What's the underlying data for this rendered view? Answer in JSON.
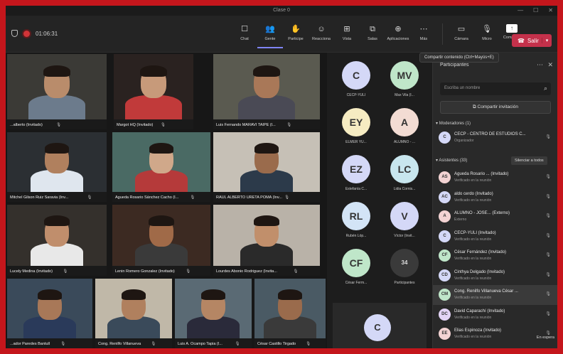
{
  "window": {
    "title": "Clase 0",
    "controls": [
      "—",
      "☐",
      "✕"
    ]
  },
  "toolbar": {
    "timer": "01:06:31",
    "buttons": [
      {
        "label": "Chat",
        "icon": "chat-icon",
        "glyph": "☐"
      },
      {
        "label": "Gente",
        "icon": "people-icon",
        "glyph": "👥"
      },
      {
        "label": "Participe",
        "icon": "raise-hand-icon",
        "glyph": "✋"
      },
      {
        "label": "Reacciona",
        "icon": "reactions-icon",
        "glyph": "☺"
      },
      {
        "label": "Vista",
        "icon": "view-icon",
        "glyph": "⊞"
      },
      {
        "label": "Salas",
        "icon": "rooms-icon",
        "glyph": "⧉"
      },
      {
        "label": "Aplicaciones",
        "icon": "apps-icon",
        "glyph": "⊕"
      },
      {
        "label": "Más",
        "icon": "more-icon",
        "glyph": "⋯"
      }
    ],
    "device_buttons": [
      {
        "label": "Cámara",
        "icon": "camera-icon",
        "glyph": "▭"
      },
      {
        "label": "Micro",
        "icon": "mic-icon",
        "glyph": "🎙"
      },
      {
        "label": "Compartir",
        "icon": "share-icon",
        "glyph": "↑"
      }
    ],
    "leave_label": "Salir",
    "share_tooltip": "Compartir contenido (Ctrl+Mayús+E)"
  },
  "tiles": [
    {
      "name": "...alberto (Invitado)"
    },
    {
      "name": "Margot HQ (Invitado)"
    },
    {
      "name": "Luis Fernando MARAVI TAIPE (I..."
    },
    {
      "name": "Mitchel Gilson Ruiz Saravia (Inv..."
    },
    {
      "name": "Agueda Rosario Sánchez Cacho (I..."
    },
    {
      "name": "RAUL ALBERTO URETA POMA (Inv..."
    },
    {
      "name": "Lucely Medina (Invitado)"
    },
    {
      "name": "Lenin Romero Gonzalez (Invitado)"
    },
    {
      "name": "Lourdes Abonio Rodriguez (Invita..."
    },
    {
      "name": "...ador Paredes Bantull"
    },
    {
      "name": "Cong. Renilfo Villanueva"
    },
    {
      "name": "Luis A. Ocampo Tapia (I..."
    },
    {
      "name": "César Castillo Tirgado"
    }
  ],
  "avatars": [
    {
      "initials": "C",
      "name": "CECP-YULI",
      "color": "#d4d8f7"
    },
    {
      "initials": "MV",
      "name": "Max Vila (I...",
      "color": "#bfe6c9"
    },
    {
      "initials": "EY",
      "name": "ELMER YU...",
      "color": "#f6ecc2"
    },
    {
      "initials": "A",
      "name": "ALUMNO - ...",
      "color": "#f3dcd3"
    },
    {
      "initials": "EZ",
      "name": "Estefanía C...",
      "color": "#d4d8f7"
    },
    {
      "initials": "LC",
      "name": "Lidia Cornis...",
      "color": "#c8e6ee"
    },
    {
      "initials": "RL",
      "name": "Rubén Lóp...",
      "color": "#d3e4f6"
    },
    {
      "initials": "V",
      "name": "Víctor (Invit...",
      "color": "#d4d8f7"
    },
    {
      "initials": "CF",
      "name": "César Ferm...",
      "color": "#bfe6c9"
    },
    {
      "initials": "34",
      "name": "Participantes",
      "color": "#3a3a3a"
    }
  ],
  "self_tile": {
    "initials": "C"
  },
  "panel": {
    "title": "Participantes",
    "search_placeholder": "Escriba un nombre",
    "invite_label": "Compartir invitación",
    "moderators_header": "Moderadores (1)",
    "moderators": [
      {
        "initials": "C",
        "name": "CECP - CENTRO DE ESTUDIOS C...",
        "role": "Organizador",
        "color": "#d4d8f7"
      }
    ],
    "attendees_header": "Asistentes (33)",
    "mute_all_label": "Silenciar a todos",
    "attendees": [
      {
        "initials": "AS",
        "name": "Agueda Rosario ... (Invitado)",
        "role": "Verificado en la reunión",
        "color": "#f3d3d3"
      },
      {
        "initials": "AC",
        "name": "aldo cerdo (Invitado)",
        "role": "Verificado en la reunión",
        "color": "#d4d8f7"
      },
      {
        "initials": "A",
        "name": "ALUMNO - JOSE... (Externo)",
        "role": "Externo",
        "color": "#f3d3d3"
      },
      {
        "initials": "C",
        "name": "CECP-YULI (Invitado)",
        "role": "Verificado en la reunión",
        "color": "#d4d8f7"
      },
      {
        "initials": "CF",
        "name": "César Fernández (Invitado)",
        "role": "Verificado en la reunión",
        "color": "#bfe6c9"
      },
      {
        "initials": "CD",
        "name": "Cinthya Delgado (Invitado)",
        "role": "Verificado en la reunión",
        "color": "#d4d8f7"
      },
      {
        "initials": "CM",
        "name": "Cong. Renilfo Villanueva César ...",
        "role": "Verificado en la reunión",
        "color": "#bfe6c9"
      },
      {
        "initials": "DC",
        "name": "David Caparachí (Invitado)",
        "role": "Verificado en la reunión",
        "color": "#e3d4f6"
      },
      {
        "initials": "EE",
        "name": "Elias Espinoza (Invitado)",
        "role": "Verificado en la reunión",
        "color": "#f3d3d3"
      }
    ],
    "waiting_label": "En espera"
  }
}
